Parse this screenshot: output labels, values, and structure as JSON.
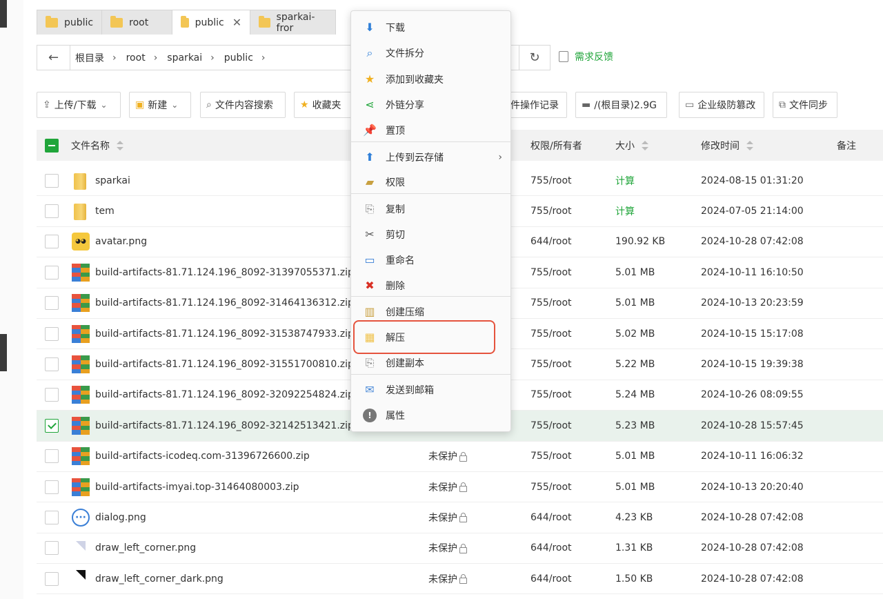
{
  "tabs": [
    {
      "label": "public",
      "active": false
    },
    {
      "label": "root",
      "active": false
    },
    {
      "label": "public",
      "active": true
    },
    {
      "label": "sparkai-fror",
      "active": false
    }
  ],
  "breadcrumb": [
    "根目录",
    "root",
    "sparkai",
    "public"
  ],
  "feedback_label": "需求反馈",
  "toolbar": {
    "upload_download": "上传/下载",
    "new": "新建",
    "content_search": "文件内容搜索",
    "favorites": "收藏夹",
    "op_log": "件操作记录",
    "disk": "/(根目录)2.9G",
    "tamper": "企业级防篡改",
    "sync": "文件同步"
  },
  "columns": {
    "name": "文件名称",
    "perm": "权限/所有者",
    "size": "大小",
    "mtime": "修改时间",
    "note": "备注"
  },
  "rows": [
    {
      "name": "sparkai",
      "icon": "folder",
      "protect": "",
      "perm": "755/root",
      "size": "计算",
      "time": "2024-08-15 01:31:20",
      "checked": false
    },
    {
      "name": "tem",
      "icon": "folder",
      "protect": "",
      "perm": "755/root",
      "size": "计算",
      "time": "2024-07-05 21:14:00",
      "checked": false
    },
    {
      "name": "avatar.png",
      "icon": "avatar",
      "protect": "",
      "perm": "644/root",
      "size": "190.92 KB",
      "time": "2024-10-28 07:42:08",
      "checked": false
    },
    {
      "name": "build-artifacts-81.71.124.196_8092-31397055371.zip",
      "icon": "zip",
      "protect": "",
      "perm": "755/root",
      "size": "5.01 MB",
      "time": "2024-10-11 16:10:50",
      "checked": false
    },
    {
      "name": "build-artifacts-81.71.124.196_8092-31464136312.zip",
      "icon": "zip",
      "protect": "",
      "perm": "755/root",
      "size": "5.01 MB",
      "time": "2024-10-13 20:23:59",
      "checked": false
    },
    {
      "name": "build-artifacts-81.71.124.196_8092-31538747933.zip",
      "icon": "zip",
      "protect": "",
      "perm": "755/root",
      "size": "5.02 MB",
      "time": "2024-10-15 15:17:08",
      "checked": false
    },
    {
      "name": "build-artifacts-81.71.124.196_8092-31551700810.zip",
      "icon": "zip",
      "protect": "",
      "perm": "755/root",
      "size": "5.22 MB",
      "time": "2024-10-15 19:39:38",
      "checked": false
    },
    {
      "name": "build-artifacts-81.71.124.196_8092-32092254824.zip",
      "icon": "zip",
      "protect": "",
      "perm": "755/root",
      "size": "5.24 MB",
      "time": "2024-10-26 08:09:55",
      "checked": false
    },
    {
      "name": "build-artifacts-81.71.124.196_8092-32142513421.zip",
      "icon": "zip",
      "protect": "",
      "perm": "755/root",
      "size": "5.23 MB",
      "time": "2024-10-28 15:57:45",
      "checked": true
    },
    {
      "name": "build-artifacts-icodeq.com-31396726600.zip",
      "icon": "zip",
      "protect": "未保护",
      "perm": "755/root",
      "size": "5.01 MB",
      "time": "2024-10-11 16:06:32",
      "checked": false
    },
    {
      "name": "build-artifacts-imyai.top-31464080003.zip",
      "icon": "zip",
      "protect": "未保护",
      "perm": "755/root",
      "size": "5.01 MB",
      "time": "2024-10-13 20:20:40",
      "checked": false
    },
    {
      "name": "dialog.png",
      "icon": "dialog",
      "protect": "未保护",
      "perm": "644/root",
      "size": "4.23 KB",
      "time": "2024-10-28 07:42:08",
      "checked": false
    },
    {
      "name": "draw_left_corner.png",
      "icon": "corner-light",
      "protect": "未保护",
      "perm": "644/root",
      "size": "1.31 KB",
      "time": "2024-10-28 07:42:08",
      "checked": false
    },
    {
      "name": "draw_left_corner_dark.png",
      "icon": "corner-dark",
      "protect": "未保护",
      "perm": "644/root",
      "size": "1.50 KB",
      "time": "2024-10-28 07:42:08",
      "checked": false
    }
  ],
  "context_menu": [
    {
      "label": "下载",
      "icon": "download-icon",
      "color": "#2f7fd8"
    },
    {
      "label": "文件拆分",
      "icon": "search-split-icon",
      "color": "#2f7fd8"
    },
    {
      "label": "添加到收藏夹",
      "icon": "star-icon",
      "color": "#f0b020"
    },
    {
      "label": "外链分享",
      "icon": "share-icon",
      "color": "#20a53a"
    },
    {
      "label": "置顶",
      "icon": "pin-icon",
      "color": "#e8a020"
    },
    {
      "label": "上传到云存储",
      "icon": "upload-cloud-icon",
      "color": "#2f7fd8"
    },
    {
      "label": "权限",
      "icon": "permission-folder-icon",
      "color": "#c8a040"
    },
    {
      "label": "复制",
      "icon": "copy-icon",
      "color": "#888888"
    },
    {
      "label": "剪切",
      "icon": "scissors-icon",
      "color": "#555555"
    },
    {
      "label": "重命名",
      "icon": "rename-icon",
      "color": "#3a7fd6"
    },
    {
      "label": "删除",
      "icon": "delete-icon",
      "color": "#d93025"
    },
    {
      "label": "创建压缩",
      "icon": "compress-icon",
      "color": "#c9a040"
    },
    {
      "label": "解压",
      "icon": "extract-icon",
      "color": "#f0c24b"
    },
    {
      "label": "创建副本",
      "icon": "duplicate-icon",
      "color": "#888888"
    },
    {
      "label": "发送到邮箱",
      "icon": "mail-icon",
      "color": "#4a8ad8"
    },
    {
      "label": "属性",
      "icon": "info-icon",
      "color": "#777777"
    }
  ]
}
